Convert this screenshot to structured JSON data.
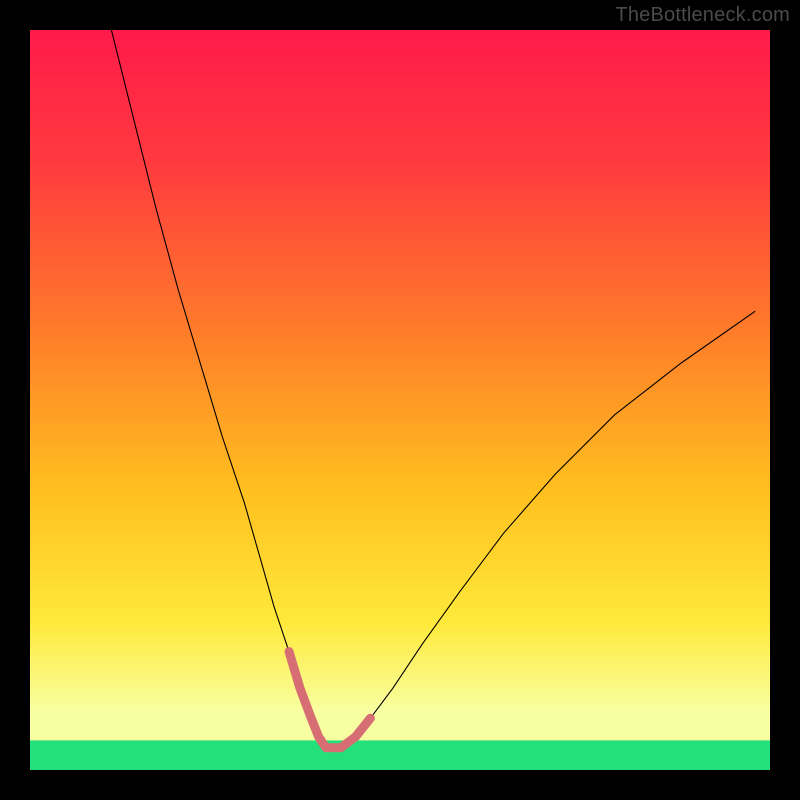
{
  "watermark": "TheBottleneck.com",
  "chart_data": {
    "type": "line",
    "title": "",
    "xlabel": "",
    "ylabel": "",
    "xlim": [
      0,
      100
    ],
    "ylim": [
      0,
      100
    ],
    "grid": false,
    "legend": false,
    "background_gradient": {
      "top_color": "#ff1a4a",
      "mid_color": "#ffd400",
      "green_band_color": "#23e07a",
      "green_band_y_range": [
        0,
        4
      ]
    },
    "series": [
      {
        "name": "bottleneck-curve",
        "stroke": "#000000",
        "stroke_width": 1.1,
        "x": [
          11,
          14,
          17,
          20,
          23,
          26,
          29,
          31,
          33,
          35,
          36.5,
          38,
          39,
          40,
          42,
          44,
          46,
          49,
          53,
          58,
          64,
          71,
          79,
          88,
          98
        ],
        "values": [
          100,
          88,
          76,
          65,
          55,
          45,
          36,
          29,
          22,
          16,
          11,
          7,
          4.5,
          3,
          3,
          4.5,
          7,
          11,
          17,
          24,
          32,
          40,
          48,
          55,
          62
        ]
      },
      {
        "name": "optimal-band-overlay",
        "stroke": "#d66e74",
        "stroke_width": 9,
        "linecap": "round",
        "x": [
          35,
          36.5,
          38,
          39,
          40,
          42,
          44,
          46
        ],
        "values": [
          16,
          11,
          7,
          4.5,
          3,
          3,
          4.5,
          7
        ]
      }
    ]
  }
}
